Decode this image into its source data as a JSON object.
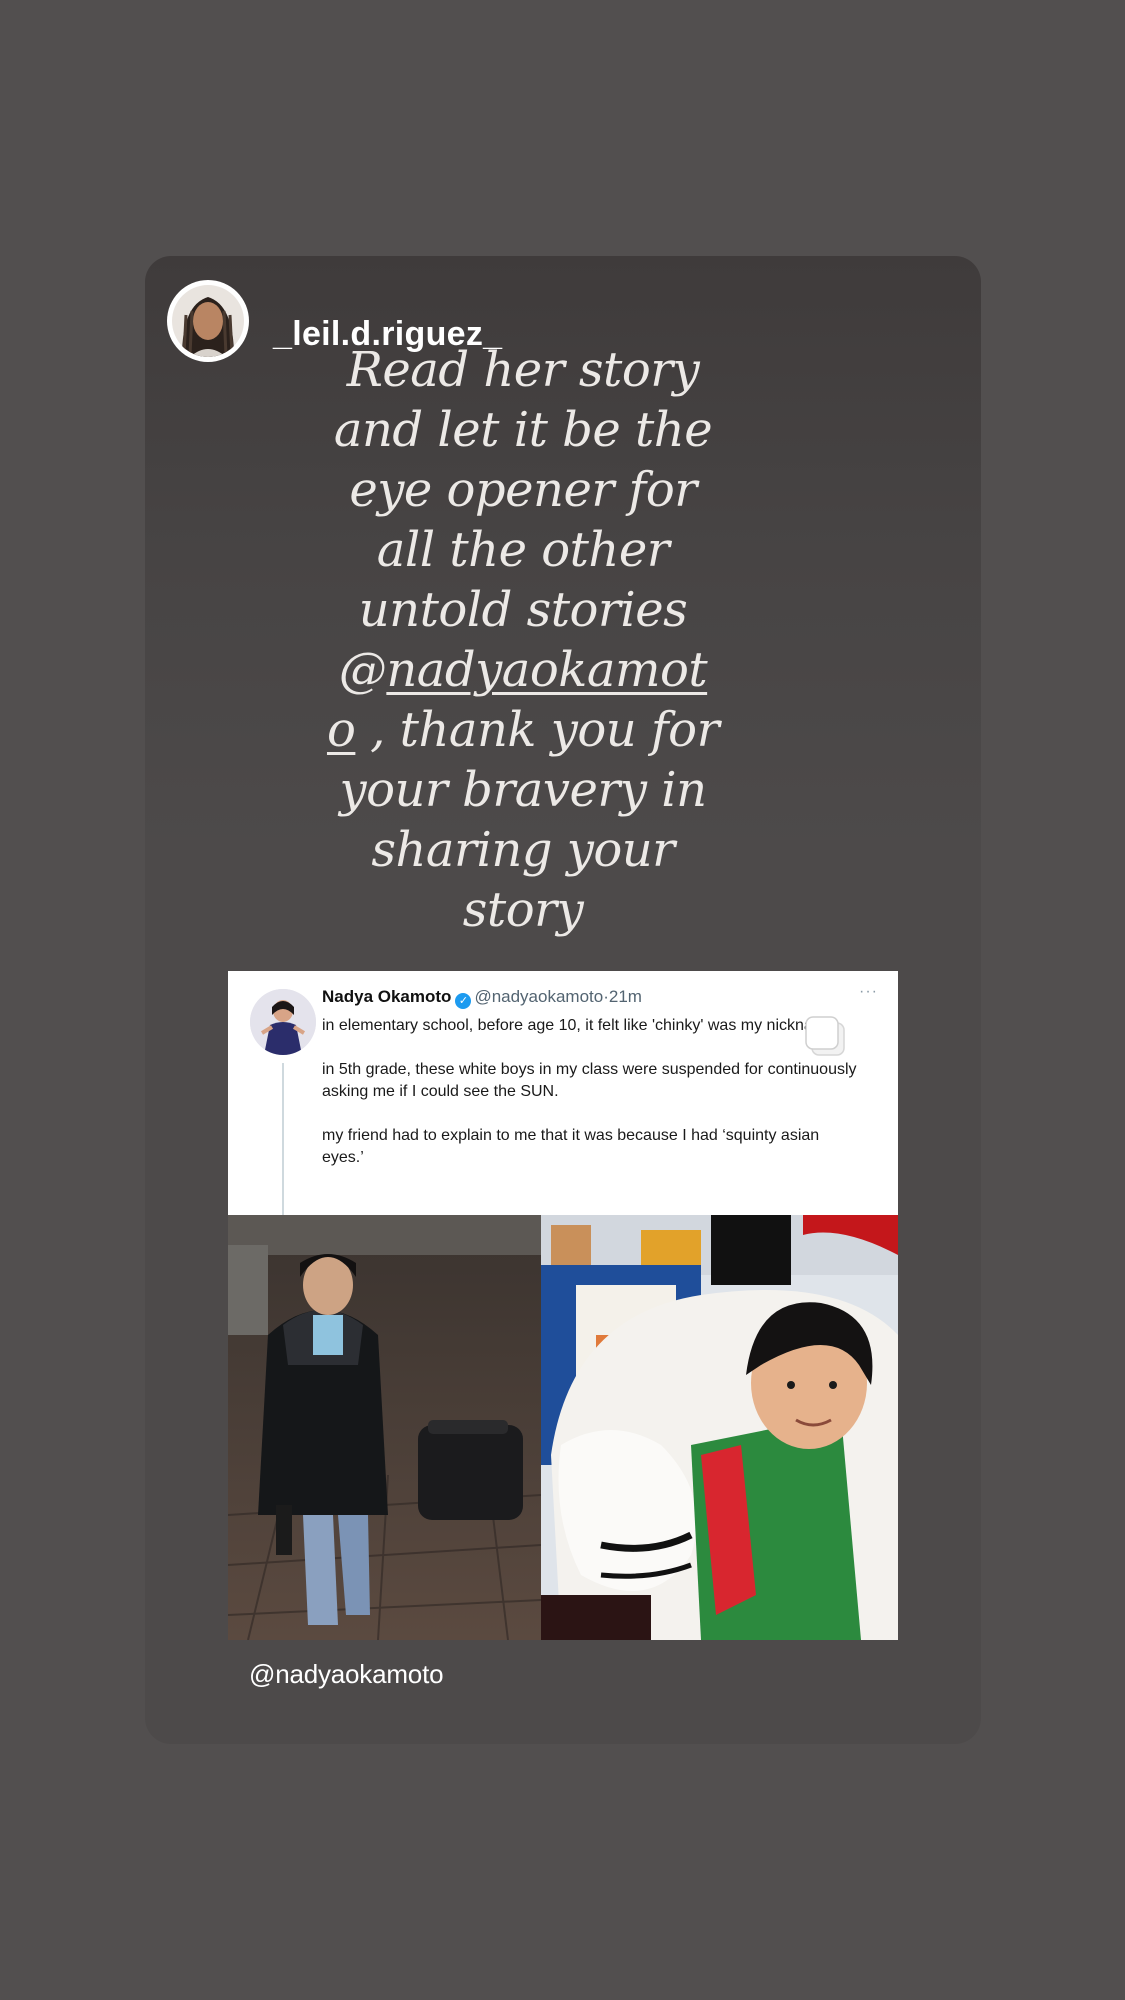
{
  "story": {
    "username": "_leil.d.riguez_",
    "caption": {
      "lines_before": [
        "Read her story",
        "and let it be the",
        "eye opener for",
        "all the other",
        "untold stories"
      ],
      "mention_prefix": "@",
      "mention_part1": "nadyaokamot",
      "mention_part2": "o",
      "after_mention": " , thank you for",
      "lines_after": [
        "your bravery in",
        "sharing your",
        "story"
      ]
    },
    "footer_mention": "@nadyaokamoto"
  },
  "tweet": {
    "name": "Nadya Okamoto",
    "handle": "@nadyaokamoto",
    "time": "·21m",
    "more": "···",
    "paragraphs": [
      "in elementary school, before age 10, it felt like 'chinky' was my nickname.",
      "in 5th grade, these white boys in my class were suspended for continuously asking me if I could see the SUN.",
      "my friend had to explain to me that it was because I had ‘squinty asian eyes.’"
    ]
  },
  "colors": {
    "background": "#524f4f",
    "card": "#4d4a4a",
    "caption_text": "#ece9e6",
    "verified": "#1d9bf0"
  },
  "icons": {
    "verified": "verified-badge-icon",
    "copy": "copy-icon",
    "more": "more-icon"
  }
}
